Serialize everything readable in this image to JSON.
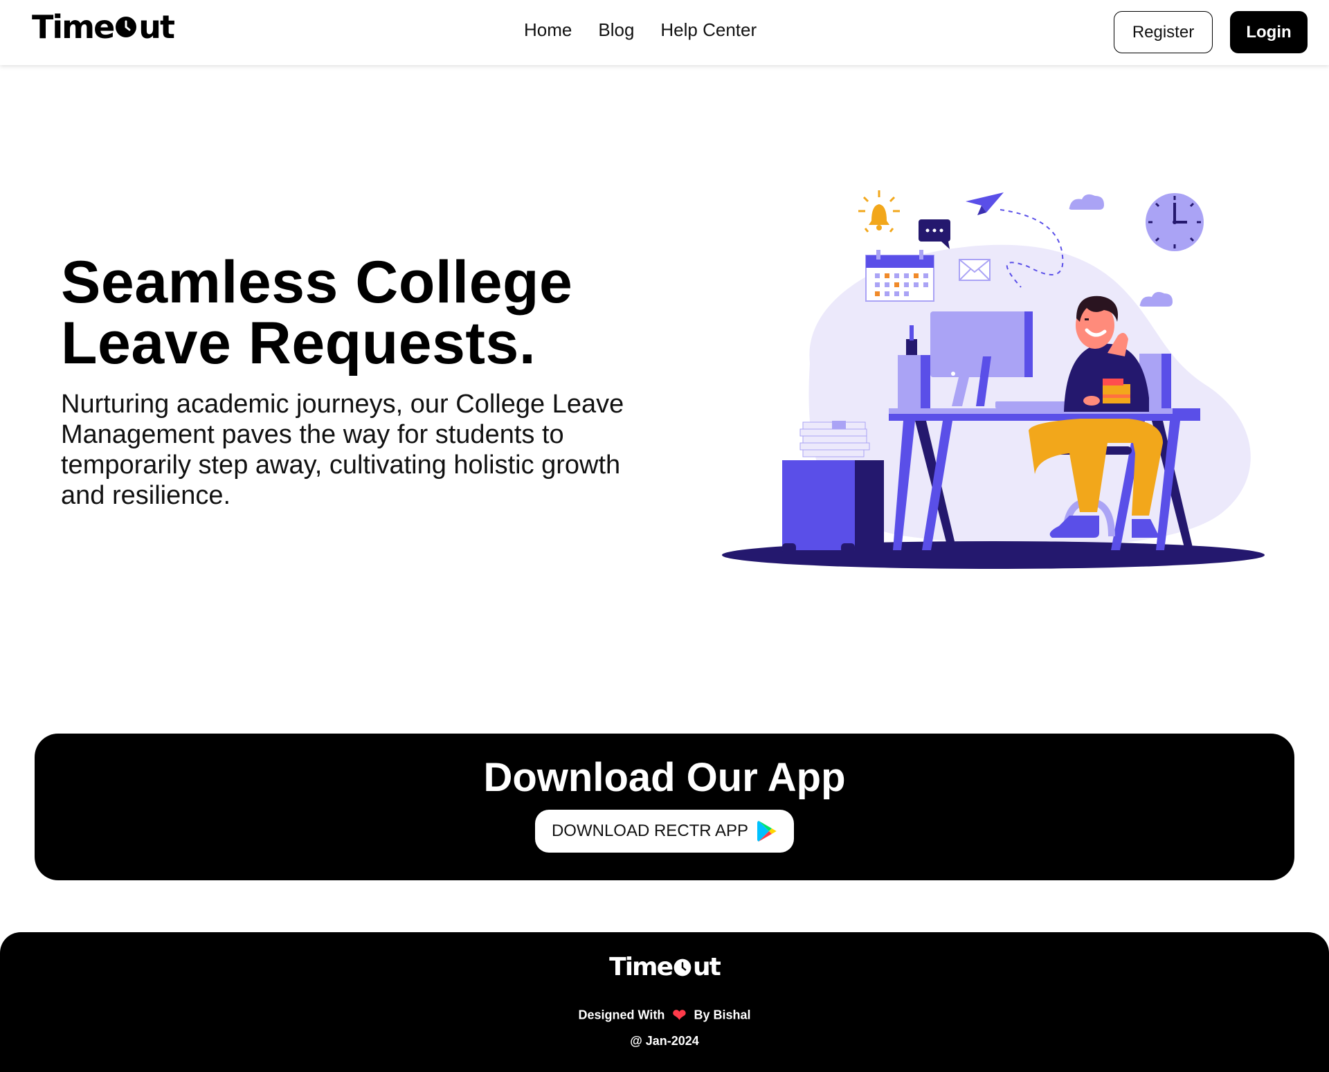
{
  "navbar": {
    "logo_text_left": "Time",
    "logo_text_right": "ut",
    "links": [
      "Home",
      "Blog",
      "Help Center"
    ],
    "register_label": "Register",
    "login_label": "Login"
  },
  "hero": {
    "title_line1": "Seamless College",
    "title_line2": "Leave Requests.",
    "subtitle": "Nurturing academic journeys, our College Leave Management paves the way for students to temporarily step away, cultivating holistic growth and resilience."
  },
  "download": {
    "title": "Download Our App",
    "button_label": "DOWNLOAD RECTR APP",
    "button_icon": "google-play-icon"
  },
  "footer": {
    "logo_text_left": "Time",
    "logo_text_right": "ut",
    "credit_prefix": "Designed With",
    "credit_suffix": "By Bishal",
    "date": "@ Jan-2024"
  },
  "colors": {
    "primary_purple": "#5a4fe8",
    "dark_navy": "#24186e",
    "light_lavender": "#ece9fb",
    "accent_orange": "#f2a71b",
    "heart_red": "#ff3b4a"
  }
}
